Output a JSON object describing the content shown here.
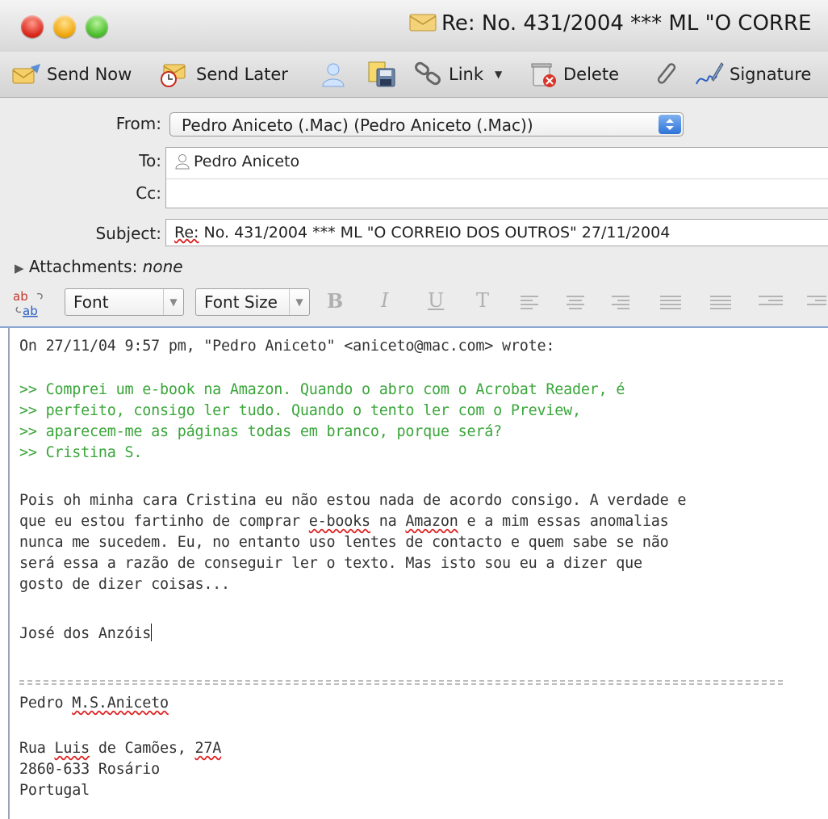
{
  "window": {
    "title": "Re: No. 431/2004 *** ML \"O CORRE"
  },
  "toolbar": {
    "send_now": "Send Now",
    "send_later": "Send Later",
    "link": "Link",
    "delete": "Delete",
    "signature": "Signature"
  },
  "header": {
    "from_label": "From:",
    "from_value": "Pedro Aniceto (.Mac) (Pedro Aniceto (.Mac))",
    "to_label": "To:",
    "to_recipient": "Pedro Aniceto",
    "cc_label": "Cc:",
    "subject_label": "Subject:",
    "subject_prefix": "Re:",
    "subject_rest": " No. 431/2004 *** ML \"O CORREIO DOS OUTROS\"  27/11/2004",
    "attachments_label": "Attachments:",
    "attachments_value": "none"
  },
  "format_bar": {
    "font": "Font",
    "font_size": "Font Size",
    "bold": "B",
    "italic": "I",
    "underline": "U",
    "text": "T"
  },
  "message": {
    "attribution": "On 27/11/04 9:57 pm, \"Pedro Aniceto\" <aniceto@mac.com> wrote:",
    "quote_lines": [
      ">> Comprei um e-book na Amazon. Quando o abro com o Acrobat Reader, é",
      ">> perfeito, consigo ler tudo. Quando o tento ler com o Preview,",
      ">> aparecem-me as páginas todas em branco, porque será?",
      ">> Cristina S."
    ],
    "reply_line1": "Pois oh minha cara Cristina eu não estou nada de acordo consigo. A verdade e",
    "reply_line2_a": "que eu estou fartinho de comprar ",
    "reply_line2_b": "e-books",
    "reply_line2_c": " na ",
    "reply_line2_d": "Amazon",
    "reply_line2_e": " e a mim essas anomalias",
    "reply_line3": "nunca me sucedem. Eu, no entanto uso lentes de contacto e quem sabe se não",
    "reply_line4": "será essa a razão de conseguir ler o texto. Mas isto sou eu a dizer que",
    "reply_line5": "gosto de dizer coisas...",
    "closing": "José dos Anzóis",
    "sig_name_a": "Pedro ",
    "sig_name_b": "M.S.Aniceto",
    "sig_addr1_a": "Rua ",
    "sig_addr1_b": "Luis",
    "sig_addr1_c": " de Camões, ",
    "sig_addr1_d": "27A",
    "sig_addr2": "2860-633 Rosário",
    "sig_addr3": "Portugal"
  }
}
